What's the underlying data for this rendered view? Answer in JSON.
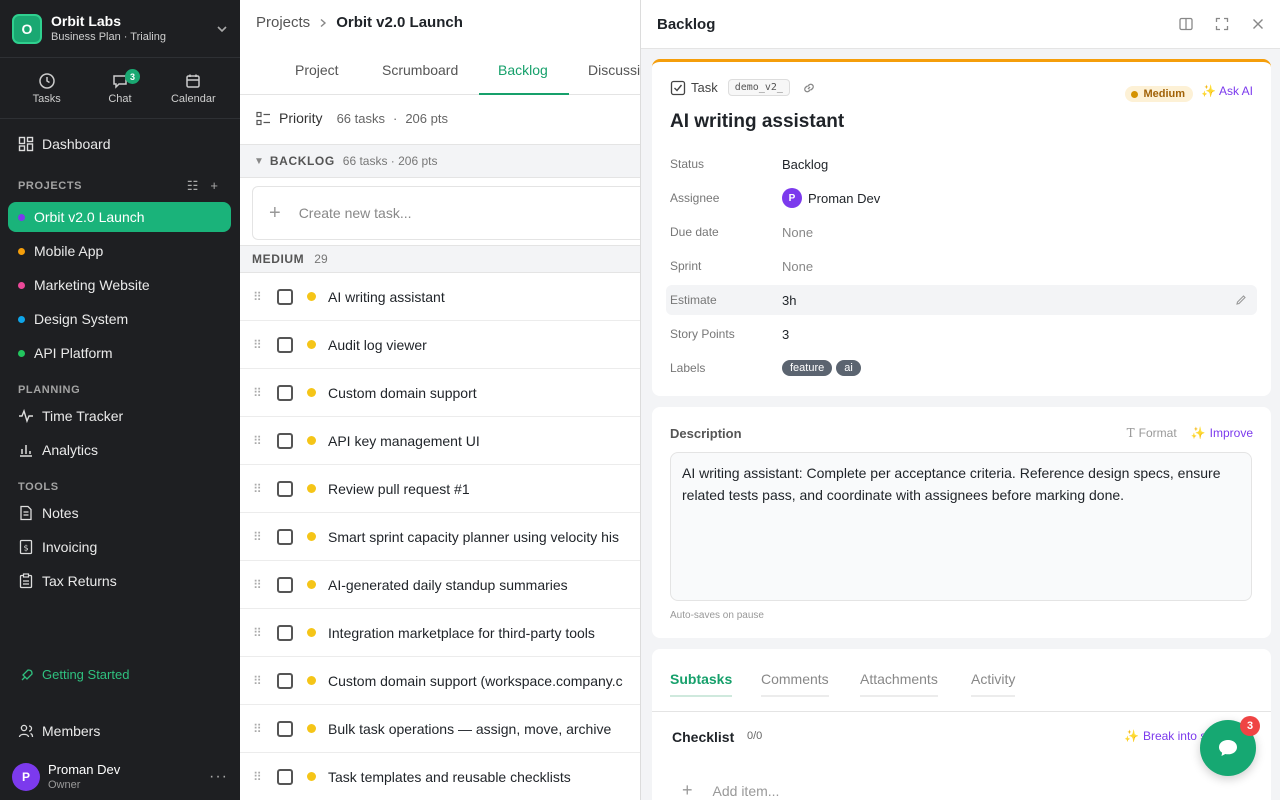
{
  "org": {
    "initial": "O",
    "name": "Orbit Labs",
    "plan": "Business Plan · Trialing"
  },
  "quick": [
    {
      "label": "Tasks",
      "icon": "clock-icon"
    },
    {
      "label": "Chat",
      "icon": "chat-icon",
      "badge": "3"
    },
    {
      "label": "Calendar",
      "icon": "calendar-icon"
    }
  ],
  "nav": {
    "dashboard": "Dashboard"
  },
  "projects": {
    "label": "PROJECTS",
    "items": [
      {
        "label": "Orbit v2.0 Launch",
        "color": "#7c3aed"
      },
      {
        "label": "Mobile App",
        "color": "#f59e0b"
      },
      {
        "label": "Marketing Website",
        "color": "#ec4899"
      },
      {
        "label": "Design System",
        "color": "#0ea5e9"
      },
      {
        "label": "API Platform",
        "color": "#22c55e"
      }
    ]
  },
  "planning": {
    "label": "PLANNING",
    "items": [
      "Time Tracker",
      "Analytics"
    ]
  },
  "tools": {
    "label": "TOOLS",
    "items": [
      "Notes",
      "Invoicing",
      "Tax Returns"
    ]
  },
  "getting_started": "Getting Started",
  "members": "Members",
  "user": {
    "initial": "P",
    "name": "Proman Dev",
    "role": "Owner"
  },
  "breadcrumb": {
    "parent": "Projects",
    "current": "Orbit v2.0 Launch"
  },
  "tabs": [
    "Project",
    "Scrumboard",
    "Backlog",
    "Discussi"
  ],
  "toolbar": {
    "group_by": "Priority",
    "count": "66 tasks",
    "sep": "·",
    "points": "206 pts"
  },
  "backlog_group": {
    "name": "BACKLOG",
    "meta": "66 tasks · 206 pts"
  },
  "create_placeholder": "Create new task...",
  "medium_group": {
    "name": "MEDIUM",
    "count": "29"
  },
  "tasks": [
    "AI writing assistant",
    "Audit log viewer",
    "Custom domain support",
    "API key management UI",
    "Review pull request #1",
    "Smart sprint capacity planner using velocity his",
    "AI-generated daily standup summaries",
    "Integration marketplace for third-party tools",
    "Custom domain support (workspace.company.c",
    "Bulk task operations — assign, move, archive",
    "Task templates and reusable checklists"
  ],
  "panel": {
    "title": "Backlog",
    "task_type": "Task",
    "task_code": "demo_v2_",
    "priority": "Medium",
    "ask_ai": "Ask AI",
    "task_title": "AI writing assistant",
    "fields": {
      "status": {
        "label": "Status",
        "value": "Backlog"
      },
      "assignee": {
        "label": "Assignee",
        "initial": "P",
        "value": "Proman Dev"
      },
      "due": {
        "label": "Due date",
        "value": "None"
      },
      "sprint": {
        "label": "Sprint",
        "value": "None"
      },
      "estimate": {
        "label": "Estimate",
        "value": "3h"
      },
      "points": {
        "label": "Story Points",
        "value": "3"
      },
      "labels": {
        "label": "Labels",
        "values": [
          "feature",
          "ai"
        ]
      }
    },
    "description": {
      "label": "Description",
      "format": "Format",
      "improve": "Improve",
      "text": "AI writing assistant: Complete per acceptance criteria. Reference design specs, ensure related tests pass, and coordinate with assignees before marking done.",
      "autosave": "Auto-saves on pause"
    },
    "subtabs": [
      "Subtasks",
      "Comments",
      "Attachments",
      "Activity"
    ],
    "checklist": {
      "label": "Checklist",
      "count": "0/0",
      "break_into": "Break into s",
      "add_placeholder": "Add item..."
    }
  },
  "fab": {
    "badge": "3"
  }
}
